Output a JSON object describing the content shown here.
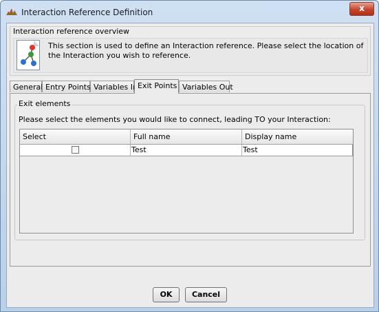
{
  "window": {
    "title": "Interaction Reference Definition",
    "close_label": "x"
  },
  "overview": {
    "title": "Interaction reference overview",
    "description": "This section is used to define an Interaction reference.  Please select the location of the Interaction you wish to reference."
  },
  "tabs": [
    {
      "label": "General"
    },
    {
      "label": "Entry Points"
    },
    {
      "label": "Variables In"
    },
    {
      "label": "Exit Points"
    },
    {
      "label": "Variables Out"
    }
  ],
  "active_tab": "Exit Points",
  "exit_elements": {
    "title": "Exit elements",
    "instruction": "Please select the elements you would like to connect, leading TO your Interaction:",
    "columns": [
      "Select",
      "Full name",
      "Display name"
    ],
    "rows": [
      {
        "selected": false,
        "full_name": "Test",
        "display_name": "Test"
      }
    ]
  },
  "buttons": {
    "ok": "OK",
    "cancel": "Cancel"
  }
}
